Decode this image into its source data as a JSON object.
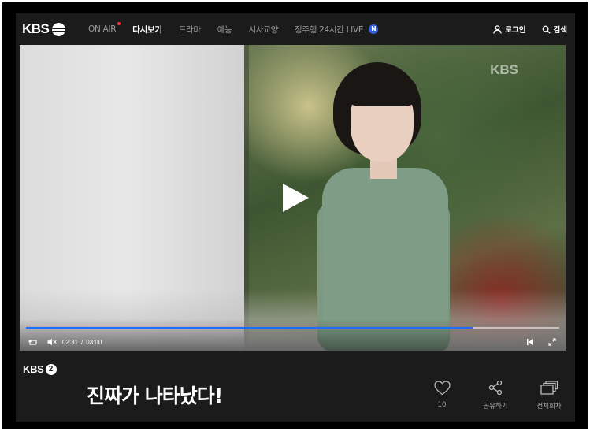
{
  "nav": {
    "logo_text": "KBS",
    "menu": [
      {
        "label": "ON AIR",
        "has_dot": true
      },
      {
        "label": "다시보기",
        "active": true
      },
      {
        "label": "드라마"
      },
      {
        "label": "예능"
      },
      {
        "label": "시사교양"
      },
      {
        "label": "정주행 24시간 LIVE",
        "badge": "N"
      }
    ],
    "login_label": "로그인",
    "search_label": "검색"
  },
  "player": {
    "watermark": "KBS",
    "current_time": "02:31",
    "time_separator": "/",
    "duration": "03:00",
    "progress_fraction": 0.838,
    "accent_color": "#1e6cff",
    "icons": [
      "replay-icon",
      "mute-icon",
      "prev-icon",
      "fullscreen-icon",
      "play-icon"
    ]
  },
  "info": {
    "channel_text": "KBS",
    "channel_number": "2",
    "title": "진짜가 나타났다!",
    "actions": [
      {
        "icon": "heart-icon",
        "label": "10"
      },
      {
        "icon": "share-icon",
        "label": "공유하기"
      },
      {
        "icon": "episodes-icon",
        "label": "전체회차"
      }
    ]
  }
}
